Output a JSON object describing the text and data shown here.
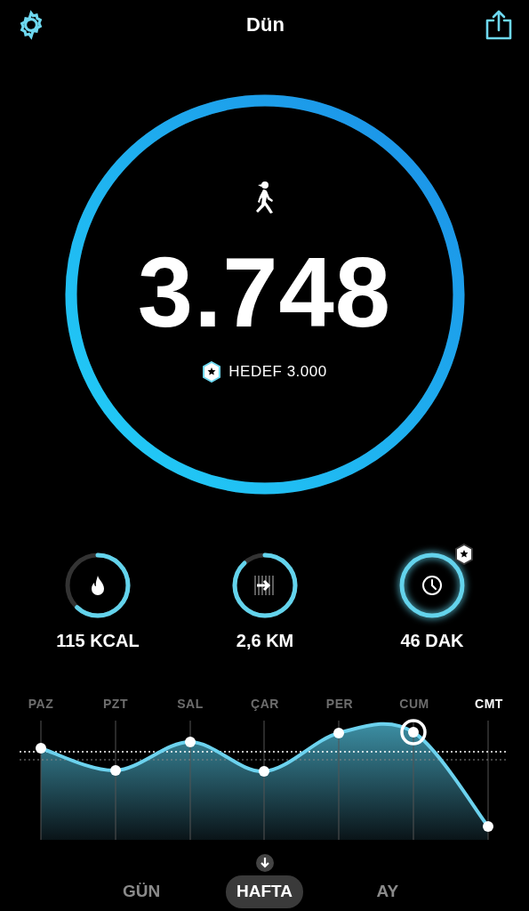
{
  "header": {
    "title": "Dün"
  },
  "steps": {
    "value": "3.748",
    "goal": "HEDEF 3.000"
  },
  "stats": [
    {
      "kind": "calories",
      "reading": "115 KCAL",
      "goal_met": false
    },
    {
      "kind": "distance",
      "reading": "2,6 KM",
      "goal_met": false
    },
    {
      "kind": "duration",
      "reading": "46 DAK",
      "goal_met": true
    }
  ],
  "days": [
    {
      "label": "PAZ",
      "selected": false
    },
    {
      "label": "PZT",
      "selected": false
    },
    {
      "label": "SAL",
      "selected": false
    },
    {
      "label": "ÇAR",
      "selected": false
    },
    {
      "label": "PER",
      "selected": false
    },
    {
      "label": "CUM",
      "selected": false
    },
    {
      "label": "CMT",
      "selected": true
    }
  ],
  "tabs": [
    {
      "label": "GÜN",
      "selected": false
    },
    {
      "label": "HAFTA",
      "selected": true
    },
    {
      "label": "AY",
      "selected": false
    }
  ]
}
